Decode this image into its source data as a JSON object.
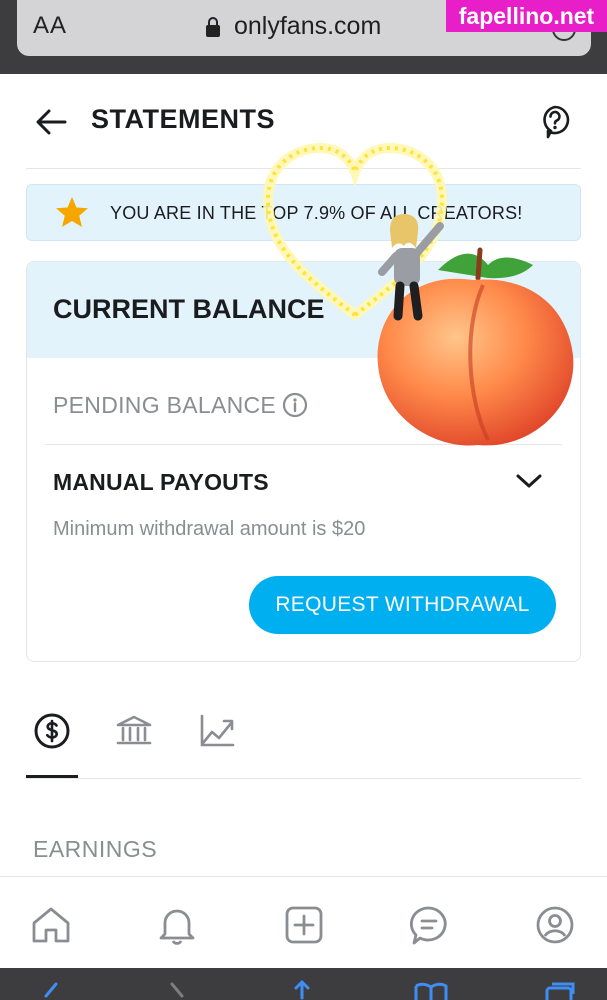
{
  "browser": {
    "text_size_label": "AA",
    "url": "onlyfans.com"
  },
  "watermark": "fapellino.net",
  "header": {
    "title": "STATEMENTS",
    "back_icon": "arrow-left-icon",
    "help_icon": "help-circle-icon"
  },
  "banner": {
    "icon": "star-icon",
    "text": "YOU ARE IN THE TOP 7.9% OF ALL CREATORS!"
  },
  "balance_card": {
    "current_balance_label": "CURRENT BALANCE",
    "pending_balance_label": "PENDING BALANCE",
    "pending_info_icon": "info-icon",
    "manual_payouts_label": "MANUAL PAYOUTS",
    "minimum_note": "Minimum withdrawal amount is $20",
    "request_button_label": "REQUEST WITHDRAWAL"
  },
  "tabs": [
    {
      "icon": "dollar-circle-icon",
      "active": true
    },
    {
      "icon": "bank-icon",
      "active": false
    },
    {
      "icon": "chart-line-icon",
      "active": false
    }
  ],
  "section_title": "EARNINGS",
  "bottom_nav": [
    {
      "icon": "home-icon"
    },
    {
      "icon": "bell-icon"
    },
    {
      "icon": "plus-square-icon"
    },
    {
      "icon": "message-icon"
    },
    {
      "icon": "profile-icon"
    }
  ],
  "colors": {
    "accent": "#00aff0",
    "banner_bg": "#e3f3fb",
    "muted_text": "#8a8d91",
    "star": "#f7a600"
  }
}
